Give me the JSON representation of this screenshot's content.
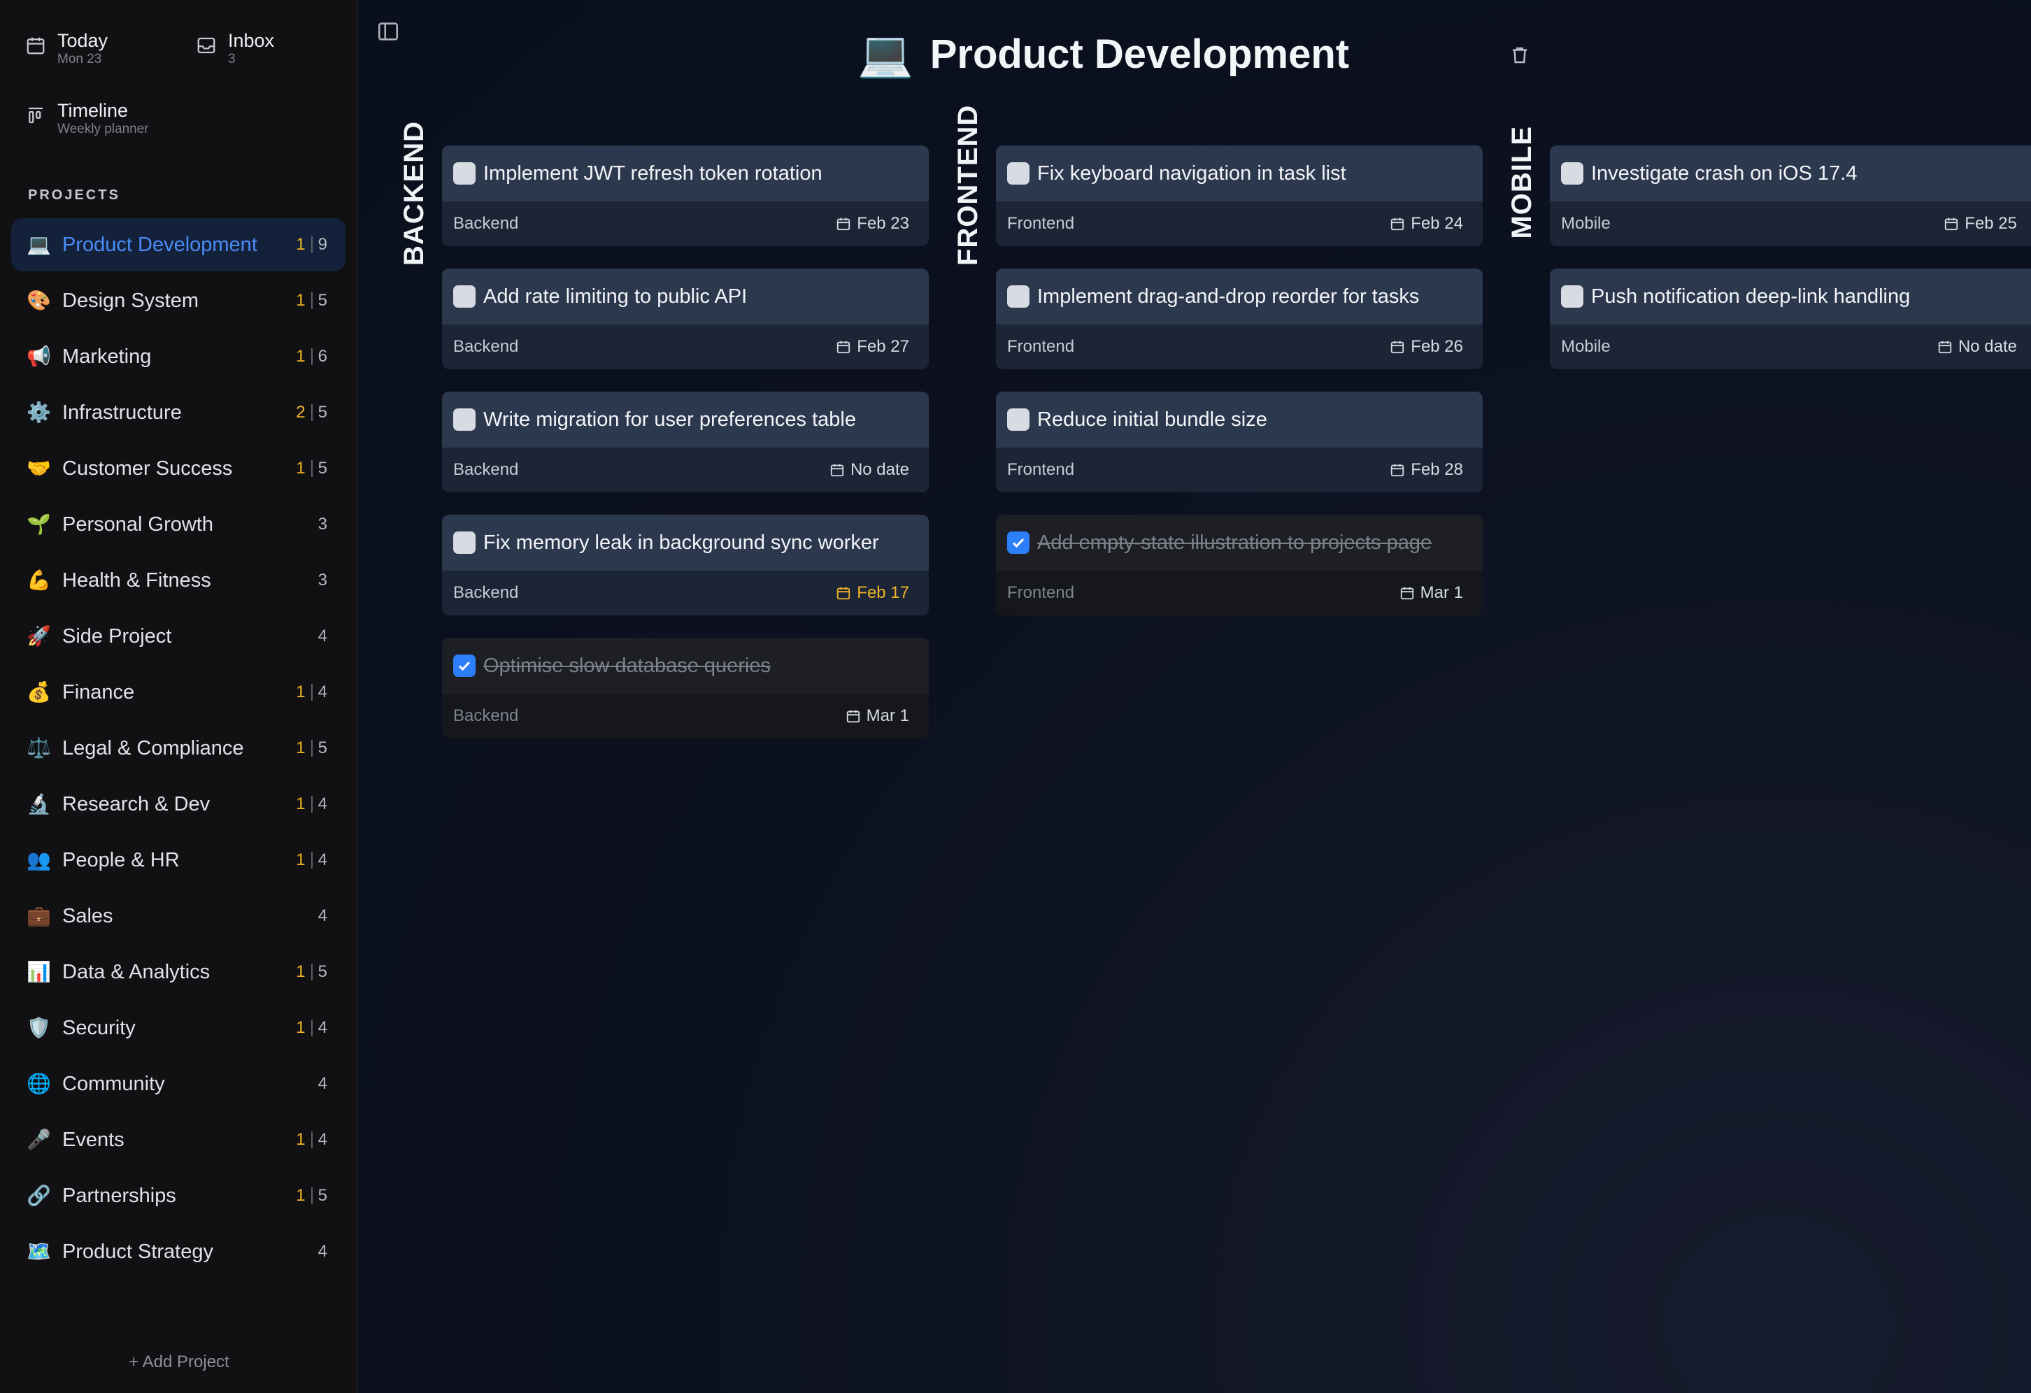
{
  "nav": {
    "today": {
      "label": "Today",
      "sub": "Mon 23"
    },
    "inbox": {
      "label": "Inbox",
      "sub": "3"
    },
    "timeline": {
      "label": "Timeline",
      "sub": "Weekly planner"
    }
  },
  "projects_heading": "PROJECTS",
  "projects": [
    {
      "emoji": "💻",
      "name": "Product Development",
      "overdue": "1",
      "total": "9",
      "active": true
    },
    {
      "emoji": "🎨",
      "name": "Design System",
      "overdue": "1",
      "total": "5"
    },
    {
      "emoji": "📢",
      "name": "Marketing",
      "overdue": "1",
      "total": "6"
    },
    {
      "emoji": "⚙️",
      "name": "Infrastructure",
      "overdue": "2",
      "total": "5"
    },
    {
      "emoji": "🤝",
      "name": "Customer Success",
      "overdue": "1",
      "total": "5"
    },
    {
      "emoji": "🌱",
      "name": "Personal Growth",
      "overdue": "",
      "total": "3"
    },
    {
      "emoji": "💪",
      "name": "Health & Fitness",
      "overdue": "",
      "total": "3"
    },
    {
      "emoji": "🚀",
      "name": "Side Project",
      "overdue": "",
      "total": "4"
    },
    {
      "emoji": "💰",
      "name": "Finance",
      "overdue": "1",
      "total": "4"
    },
    {
      "emoji": "⚖️",
      "name": "Legal & Compliance",
      "overdue": "1",
      "total": "5"
    },
    {
      "emoji": "🔬",
      "name": "Research & Dev",
      "overdue": "1",
      "total": "4"
    },
    {
      "emoji": "👥",
      "name": "People & HR",
      "overdue": "1",
      "total": "4"
    },
    {
      "emoji": "💼",
      "name": "Sales",
      "overdue": "",
      "total": "4"
    },
    {
      "emoji": "📊",
      "name": "Data & Analytics",
      "overdue": "1",
      "total": "5"
    },
    {
      "emoji": "🛡️",
      "name": "Security",
      "overdue": "1",
      "total": "4"
    },
    {
      "emoji": "🌐",
      "name": "Community",
      "overdue": "",
      "total": "4"
    },
    {
      "emoji": "🎤",
      "name": "Events",
      "overdue": "1",
      "total": "4"
    },
    {
      "emoji": "🔗",
      "name": "Partnerships",
      "overdue": "1",
      "total": "5"
    },
    {
      "emoji": "🗺️",
      "name": "Product Strategy",
      "overdue": "",
      "total": "4"
    }
  ],
  "add_project": "+ Add Project",
  "page": {
    "emoji": "💻",
    "title": "Product Development"
  },
  "columns": [
    {
      "label": "BACKEND",
      "cards": [
        {
          "title": "Implement JWT refresh token rotation",
          "tag": "Backend",
          "date": "Feb 23",
          "done": false,
          "overdue": false
        },
        {
          "title": "Add rate limiting to public API",
          "tag": "Backend",
          "date": "Feb 27",
          "done": false,
          "overdue": false
        },
        {
          "title": "Write migration for user preferences table",
          "tag": "Backend",
          "date": "No date",
          "done": false,
          "overdue": false
        },
        {
          "title": "Fix memory leak in background sync worker",
          "tag": "Backend",
          "date": "Feb 17",
          "done": false,
          "overdue": true
        },
        {
          "title": "Optimise slow database queries",
          "tag": "Backend",
          "date": "Mar 1",
          "done": true,
          "overdue": false
        }
      ]
    },
    {
      "label": "FRONTEND",
      "cards": [
        {
          "title": "Fix keyboard navigation in task list",
          "tag": "Frontend",
          "date": "Feb 24",
          "done": false,
          "overdue": false
        },
        {
          "title": "Implement drag-and-drop reorder for tasks",
          "tag": "Frontend",
          "date": "Feb 26",
          "done": false,
          "overdue": false
        },
        {
          "title": "Reduce initial bundle size",
          "tag": "Frontend",
          "date": "Feb 28",
          "done": false,
          "overdue": false
        },
        {
          "title": "Add empty-state illustration to projects page",
          "tag": "Frontend",
          "date": "Mar 1",
          "done": true,
          "overdue": false
        }
      ]
    },
    {
      "label": "MOBILE",
      "cards": [
        {
          "title": "Investigate crash on iOS 17.4",
          "tag": "Mobile",
          "date": "Feb 25",
          "done": false,
          "overdue": false
        },
        {
          "title": "Push notification deep-link handling",
          "tag": "Mobile",
          "date": "No date",
          "done": false,
          "overdue": false
        }
      ]
    }
  ],
  "colors": {
    "accent": "#2d7ff9",
    "active_text": "#4a8df8",
    "overdue": "#f0b429",
    "card": "#2c384d"
  },
  "icons": {
    "today": "calendar-icon",
    "inbox": "inbox-icon",
    "timeline": "timeline-icon",
    "toggle": "sidebar-toggle-icon",
    "delete": "trash-icon",
    "date": "calendar-icon",
    "done": "checkmark-icon"
  }
}
